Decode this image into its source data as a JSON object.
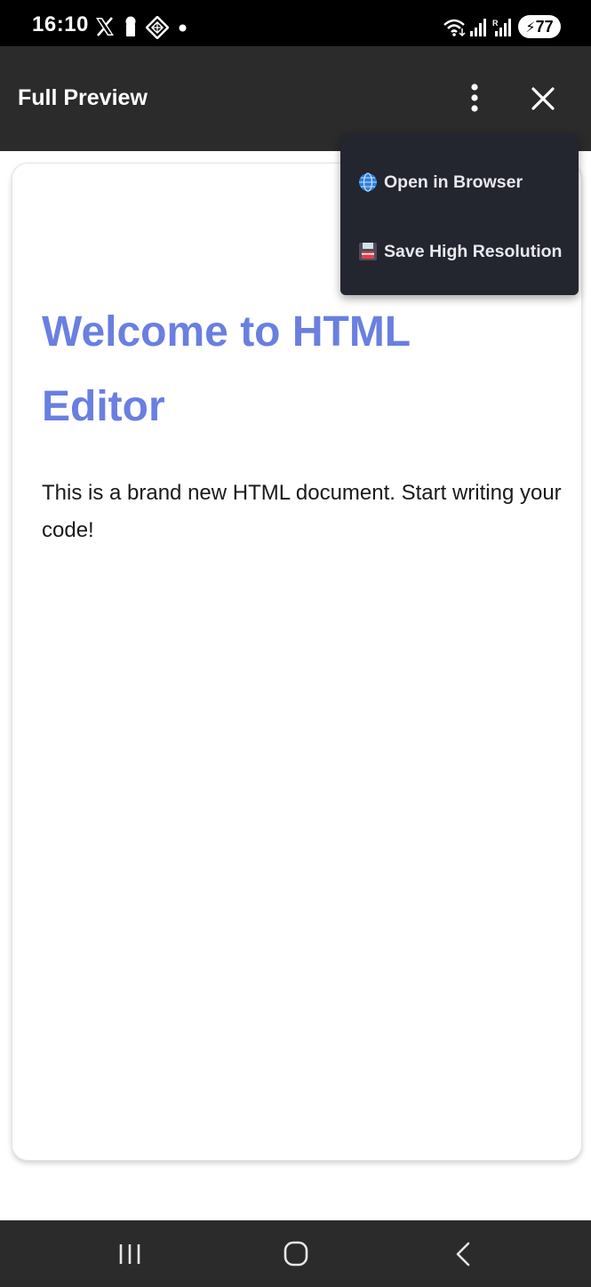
{
  "status_bar": {
    "time": "16:10",
    "battery": "77",
    "icons": [
      "x-icon",
      "keyhole-icon",
      "diamond-icon",
      "dot-icon",
      "wifi-icon",
      "signal-icon",
      "signal-r-icon"
    ]
  },
  "header": {
    "title": "Full Preview",
    "more_icon": "more-vertical-icon",
    "close_icon": "close-icon"
  },
  "menu": {
    "items": [
      {
        "label": "Open in Browser",
        "icon": "globe-icon"
      },
      {
        "label": "Save High Resolution",
        "icon": "floppy-disk-icon"
      }
    ]
  },
  "preview": {
    "heading": "Welcome to HTML Editor",
    "paragraph": "This is a brand new HTML document. Start writing your code!",
    "heading_color": "#6a7fe0"
  },
  "nav": {
    "icons": [
      "recent-apps-icon",
      "home-icon",
      "back-icon"
    ]
  }
}
